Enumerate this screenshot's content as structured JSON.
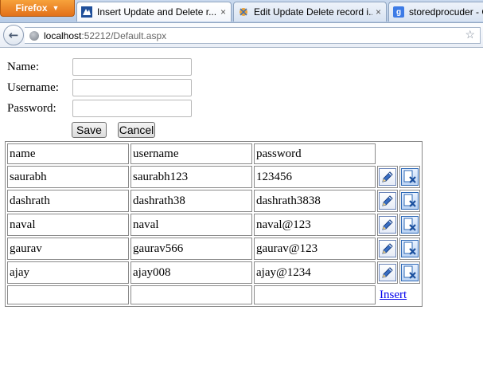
{
  "browser": {
    "firefox_label": "Firefox",
    "tabs": [
      {
        "title": "Insert Update and Delete r...",
        "close": "×"
      },
      {
        "title": "Edit Update Delete record i...",
        "close": "×"
      },
      {
        "title": "storedprocuder - G",
        "close": ""
      }
    ],
    "url_host": "localhost",
    "url_path": ":52212/Default.aspx",
    "tab3_favicon_letter": "g"
  },
  "form": {
    "name_label": "Name:",
    "username_label": "Username:",
    "password_label": "Password:",
    "name_value": "",
    "username_value": "",
    "password_value": "",
    "save_label": "Save",
    "cancel_label": "Cancel"
  },
  "grid": {
    "headers": [
      "name",
      "username",
      "password"
    ],
    "rows": [
      {
        "name": "saurabh",
        "username": "saurabh123",
        "password": "123456"
      },
      {
        "name": "dashrath",
        "username": "dashrath38",
        "password": "dashrath3838"
      },
      {
        "name": "naval",
        "username": "naval",
        "password": "naval@123"
      },
      {
        "name": "gaurav",
        "username": "gaurav566",
        "password": "gaurav@123"
      },
      {
        "name": "ajay",
        "username": "ajay008",
        "password": "ajay@1234"
      }
    ],
    "insert_label": "Insert"
  }
}
